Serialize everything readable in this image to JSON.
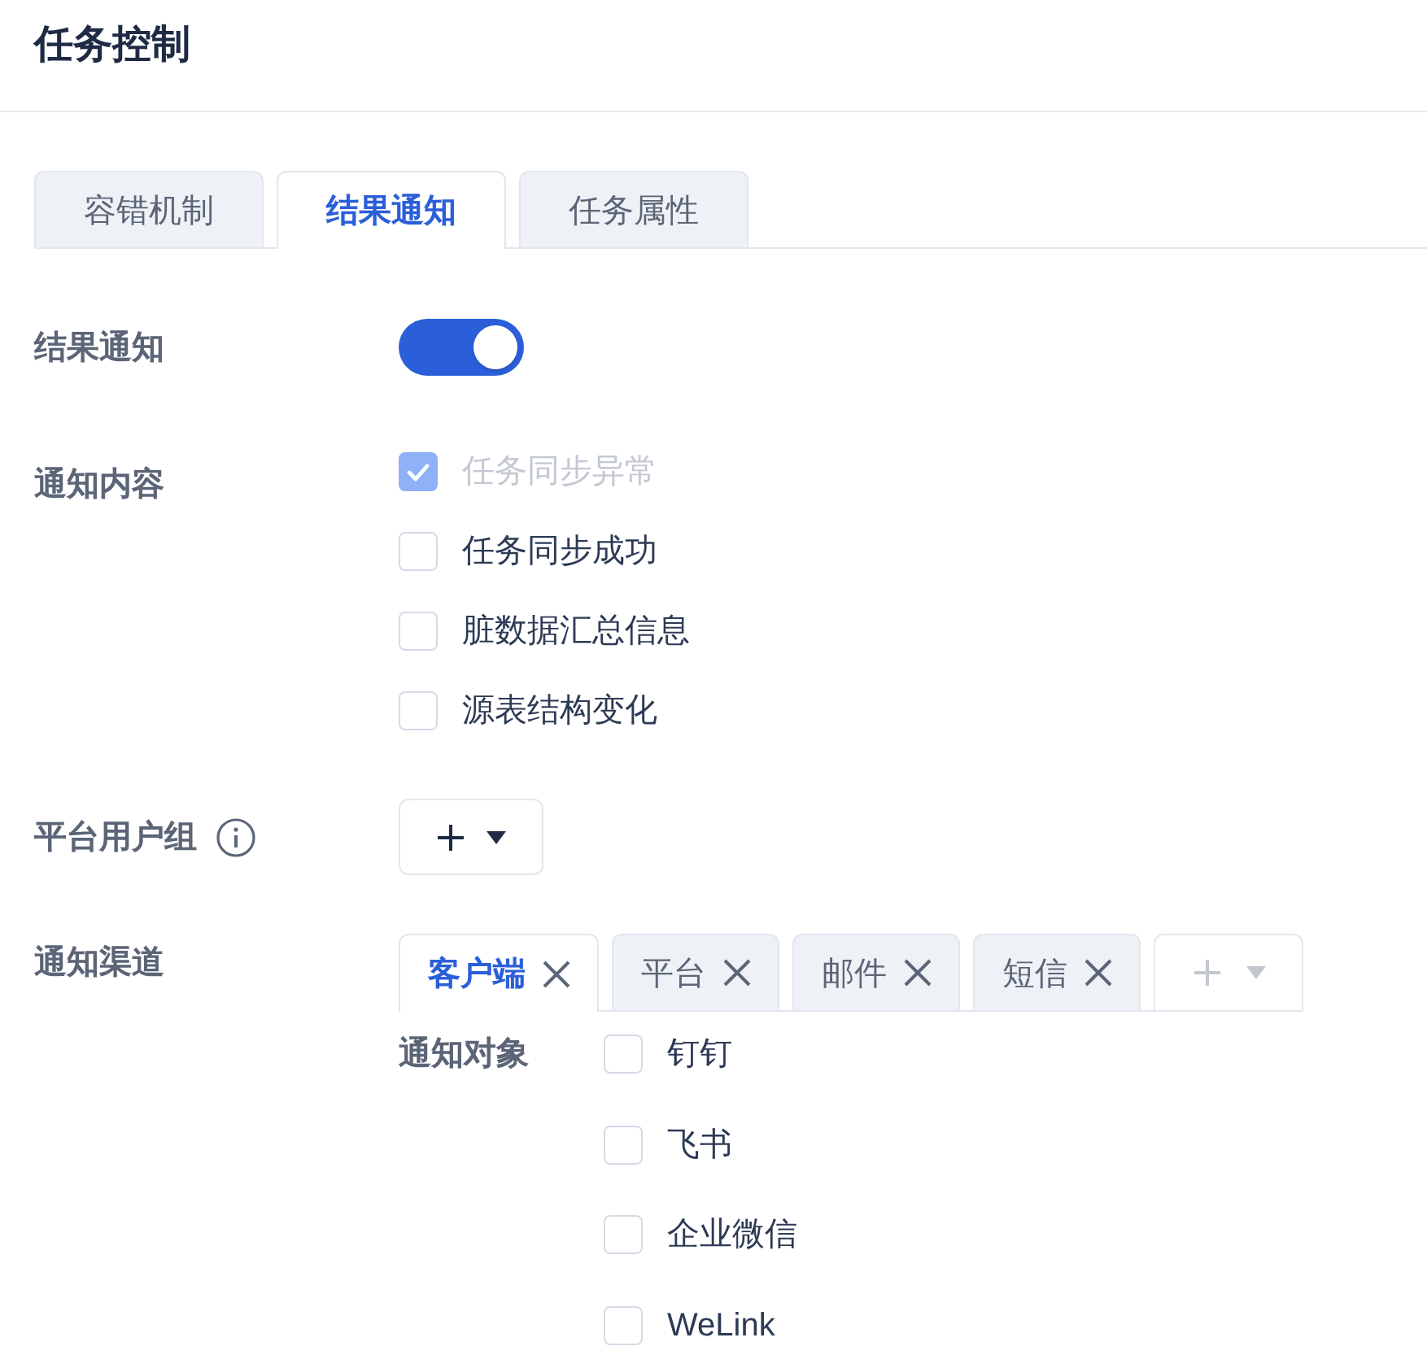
{
  "header": {
    "title": "任务控制"
  },
  "tabs": [
    {
      "label": "容错机制",
      "selected": false
    },
    {
      "label": "结果通知",
      "selected": true
    },
    {
      "label": "任务属性",
      "selected": false
    }
  ],
  "form": [
    {
      "kind": "toggle",
      "label": "结果通知",
      "on": true
    },
    {
      "kind": "checklist",
      "label": "通知内容",
      "options": [
        {
          "label": "任务同步异常",
          "checked": true,
          "disabled": true
        },
        {
          "label": "任务同步成功",
          "checked": false,
          "disabled": false
        },
        {
          "label": "脏数据汇总信息",
          "checked": false,
          "disabled": false
        },
        {
          "label": "源表结构变化",
          "checked": false,
          "disabled": false
        }
      ]
    },
    {
      "kind": "picker",
      "label": "平台用户组",
      "info": true
    },
    {
      "kind": "channels",
      "label": "通知渠道",
      "channels": [
        {
          "label": "客户端",
          "selected": true
        },
        {
          "label": "平台",
          "selected": false
        },
        {
          "label": "邮件",
          "selected": false
        },
        {
          "label": "短信",
          "selected": false
        }
      ],
      "target": {
        "label": "通知对象",
        "options": [
          {
            "label": "钉钉",
            "checked": false
          },
          {
            "label": "飞书",
            "checked": false
          },
          {
            "label": "企业微信",
            "checked": false
          },
          {
            "label": "WeLink",
            "checked": false
          }
        ]
      }
    }
  ]
}
